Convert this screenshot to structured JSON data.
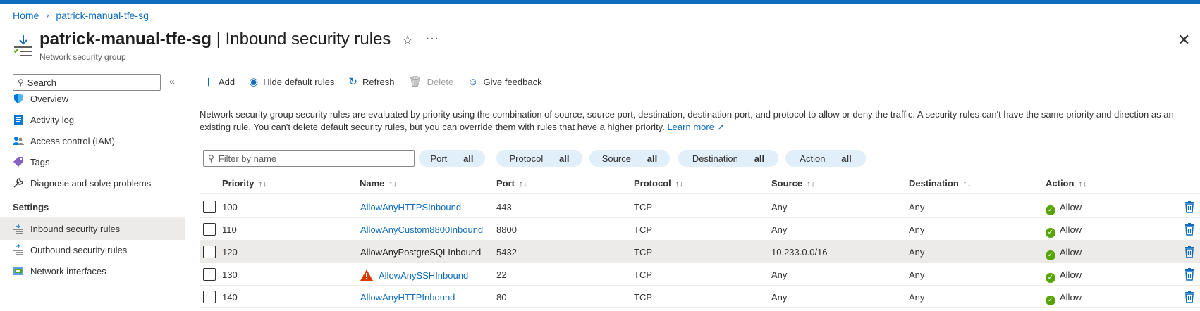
{
  "breadcrumb": {
    "home": "Home",
    "current": "patrick-manual-tfe-sg"
  },
  "header": {
    "resource_name": "patrick-manual-tfe-sg",
    "page_name": "| Inbound security rules",
    "subtitle": "Network security group"
  },
  "sidebar": {
    "search_placeholder": "Search",
    "items": [
      {
        "label": "Overview",
        "icon": "shield-icon"
      },
      {
        "label": "Activity log",
        "icon": "activity-log-icon"
      },
      {
        "label": "Access control (IAM)",
        "icon": "people-icon"
      },
      {
        "label": "Tags",
        "icon": "tag-icon"
      },
      {
        "label": "Diagnose and solve problems",
        "icon": "wrench-icon"
      }
    ],
    "section_settings": "Settings",
    "settings_items": [
      {
        "label": "Inbound security rules",
        "icon": "inbound-rules-icon",
        "selected": true
      },
      {
        "label": "Outbound security rules",
        "icon": "outbound-rules-icon",
        "selected": false
      },
      {
        "label": "Network interfaces",
        "icon": "network-interface-icon",
        "selected": false
      }
    ]
  },
  "toolbar": {
    "add": "Add",
    "hide_default": "Hide default rules",
    "refresh": "Refresh",
    "delete": "Delete",
    "feedback": "Give feedback"
  },
  "description": {
    "text": "Network security group security rules are evaluated by priority using the combination of source, source port, destination, destination port, and protocol to allow or deny the traffic. A security rules can't have the same priority and direction as an existing rule. You can't delete default security rules, but you can override them with rules that have a higher priority.",
    "learn_more": "Learn more"
  },
  "filters": {
    "filter_placeholder": "Filter by name",
    "port": {
      "label": "Port ==",
      "value": "all"
    },
    "protocol": {
      "label": "Protocol ==",
      "value": "all"
    },
    "source": {
      "label": "Source ==",
      "value": "all"
    },
    "destination": {
      "label": "Destination ==",
      "value": "all"
    },
    "action": {
      "label": "Action ==",
      "value": "all"
    }
  },
  "table": {
    "headers": {
      "priority": "Priority",
      "name": "Name",
      "port": "Port",
      "protocol": "Protocol",
      "source": "Source",
      "destination": "Destination",
      "action": "Action"
    },
    "rows": [
      {
        "priority": "100",
        "name": "AllowAnyHTTPSInbound",
        "port": "443",
        "protocol": "TCP",
        "source": "Any",
        "destination": "Any",
        "action": "Allow"
      },
      {
        "priority": "110",
        "name": "AllowAnyCustom8800Inbound",
        "port": "8800",
        "protocol": "TCP",
        "source": "Any",
        "destination": "Any",
        "action": "Allow"
      },
      {
        "priority": "120",
        "name": "AllowAnyPostgreSQLInbound",
        "port": "5432",
        "protocol": "TCP",
        "source": "10.233.0.0/16",
        "destination": "Any",
        "action": "Allow"
      },
      {
        "priority": "130",
        "name": "AllowAnySSHInbound",
        "port": "22",
        "protocol": "TCP",
        "source": "Any",
        "destination": "Any",
        "action": "Allow"
      },
      {
        "priority": "140",
        "name": "AllowAnyHTTPInbound",
        "port": "80",
        "protocol": "TCP",
        "source": "Any",
        "destination": "Any",
        "action": "Allow"
      }
    ]
  },
  "colors": {
    "accent": "#0f6cbd",
    "allow": "#57a300",
    "warning": "#d83b01",
    "selected_bg": "#edebe9",
    "pill_bg": "#e1effa"
  }
}
